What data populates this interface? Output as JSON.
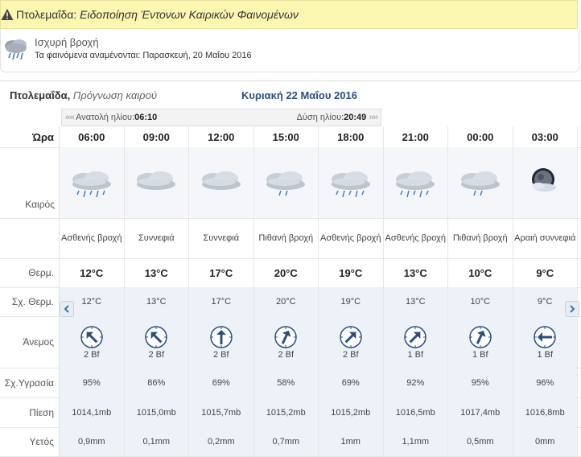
{
  "alert": {
    "prefix": "Πτολεμαΐδα:",
    "text": "Ειδοποίηση Έντονων Καιρικών Φαινομένων"
  },
  "warning": {
    "title": "Ισχυρή βροχή",
    "label": "Τα φαινόμενα αναμένονται:",
    "when": "Παρασκευή, 20 Μαΐου 2016"
  },
  "forecast": {
    "location": "Πτολεμαΐδα,",
    "subtitle": "Πρόγνωση καιρού",
    "date": "Κυριακή 22 Μαΐου 2016",
    "sunrise_label": "Ανατολή ηλίου:",
    "sunrise": "06:10",
    "sunset_label": "Δύση ηλίου:",
    "sunset": "20:49",
    "row_labels": {
      "hour": "Ώρα",
      "weather": "Καιρός",
      "temp": "Θερμ.",
      "feels": "Σχ. Θερμ.",
      "wind": "Άνεμος",
      "humidity": "Σχ.Υγρασία",
      "pressure": "Πίεση",
      "rain": "Υετός"
    },
    "hours": [
      {
        "time": "06:00",
        "icon": "rain-cloud-icon",
        "cond": "Ασθενής βροχή",
        "temp": "12°C",
        "feels": "12°C",
        "wind_dir": "NW",
        "wind": "2 Bf",
        "humidity": "95%",
        "pressure": "1014,1mb",
        "rain": "0,9mm"
      },
      {
        "time": "09:00",
        "icon": "cloudy-icon",
        "cond": "Συννεφιά",
        "temp": "13°C",
        "feels": "13°C",
        "wind_dir": "NW",
        "wind": "2 Bf",
        "humidity": "86%",
        "pressure": "1015,0mb",
        "rain": "0,1mm"
      },
      {
        "time": "12:00",
        "icon": "cloudy-icon",
        "cond": "Συννεφιά",
        "temp": "17°C",
        "feels": "17°C",
        "wind_dir": "N",
        "wind": "2 Bf",
        "humidity": "69%",
        "pressure": "1015,7mb",
        "rain": "0,2mm"
      },
      {
        "time": "15:00",
        "icon": "light-rain-icon",
        "cond": "Πιθανή βροχή",
        "temp": "20°C",
        "feels": "20°C",
        "wind_dir": "NNE",
        "wind": "2 Bf",
        "humidity": "58%",
        "pressure": "1015,2mb",
        "rain": "0,7mm"
      },
      {
        "time": "18:00",
        "icon": "rain-cloud-icon",
        "cond": "Ασθενής βροχή",
        "temp": "19°C",
        "feels": "19°C",
        "wind_dir": "NE",
        "wind": "2 Bf",
        "humidity": "69%",
        "pressure": "1015,2mb",
        "rain": "1mm"
      },
      {
        "time": "21:00",
        "icon": "rain-cloud-icon",
        "cond": "Ασθενής βροχή",
        "temp": "13°C",
        "feels": "13°C",
        "wind_dir": "NE",
        "wind": "1 Bf",
        "humidity": "92%",
        "pressure": "1016,5mb",
        "rain": "1,1mm"
      },
      {
        "time": "00:00",
        "icon": "light-rain-icon",
        "cond": "Πιθανή βροχή",
        "temp": "10°C",
        "feels": "10°C",
        "wind_dir": "NNE",
        "wind": "1 Bf",
        "humidity": "95%",
        "pressure": "1017,4mb",
        "rain": "0,5mm"
      },
      {
        "time": "03:00",
        "icon": "moon-cloud-icon",
        "cond": "Αραιή συννεφιά",
        "temp": "9°C",
        "feels": "9°C",
        "wind_dir": "W",
        "wind": "1 Bf",
        "humidity": "96%",
        "pressure": "1016,8mb",
        "rain": "0mm"
      }
    ]
  },
  "colors": {
    "alert_bg": "#fbf6b0",
    "date": "#2a4f83",
    "shade": "#edf2f8",
    "arrow": "#2a4f83"
  }
}
